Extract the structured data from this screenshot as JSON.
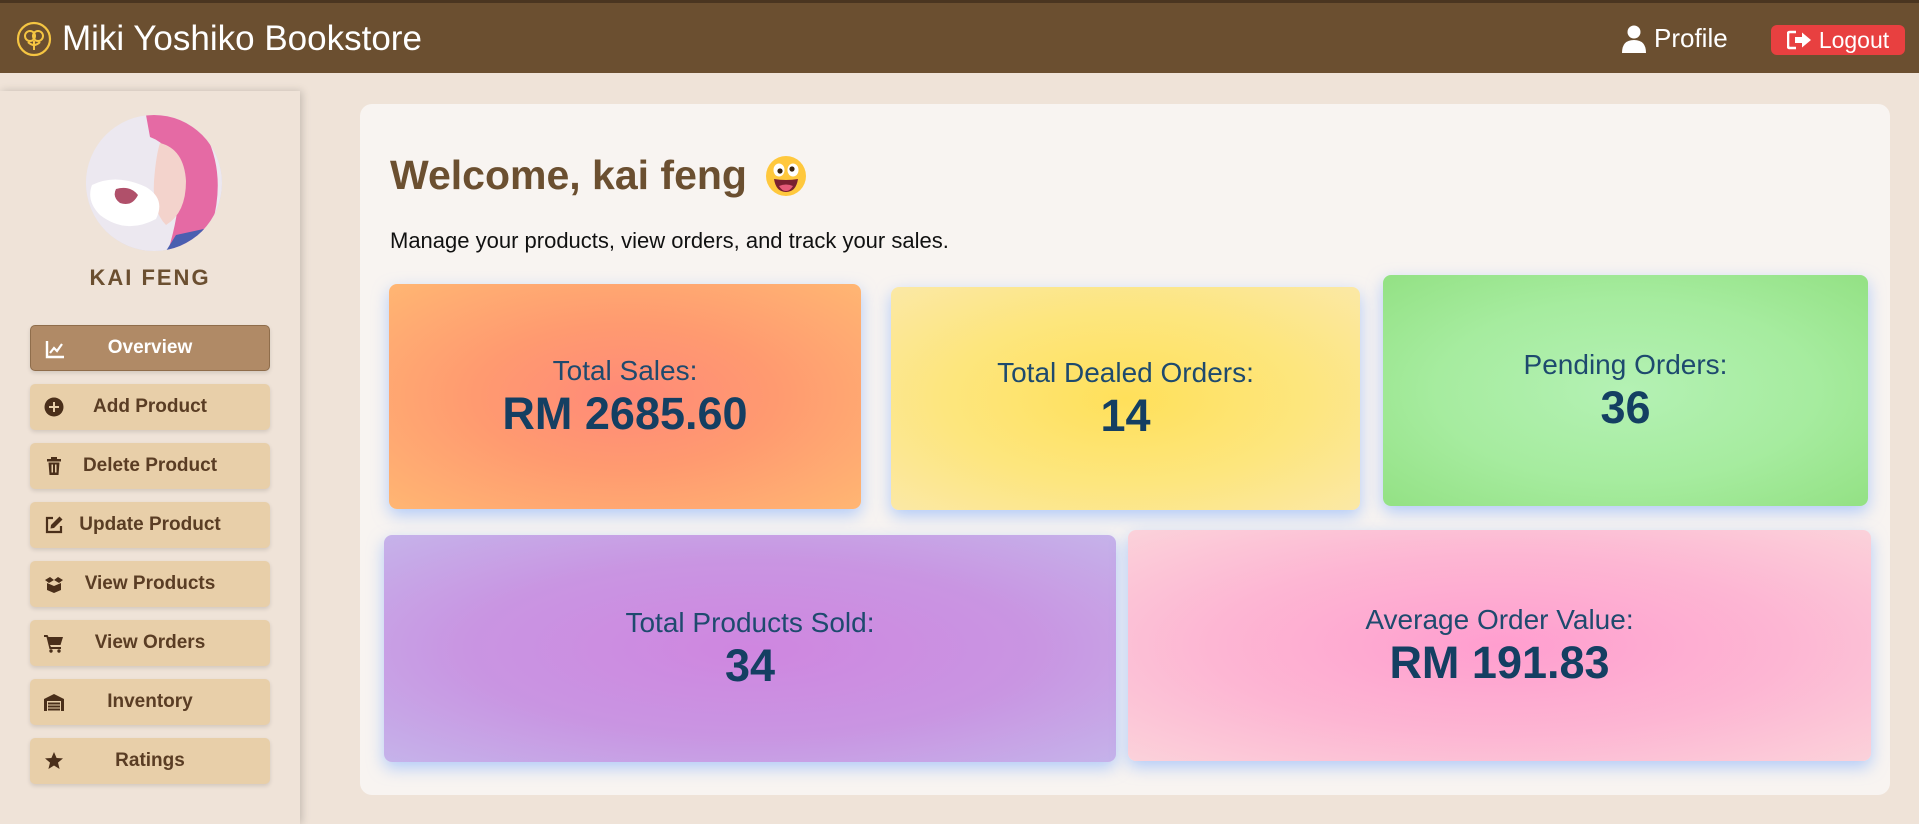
{
  "navbar": {
    "brand": "Miki Yoshiko Bookstore",
    "brand_icon": "flower-logo-icon",
    "profile_label": "Profile",
    "logout_label": "Logout"
  },
  "sidebar": {
    "user_name": "KAI FENG",
    "items": [
      {
        "label": "Overview",
        "icon": "chart-line-icon",
        "active": true
      },
      {
        "label": "Add Product",
        "icon": "plus-circle-icon"
      },
      {
        "label": "Delete Product",
        "icon": "trash-icon"
      },
      {
        "label": "Update Product",
        "icon": "edit-icon"
      },
      {
        "label": "View Products",
        "icon": "box-open-icon"
      },
      {
        "label": "View Orders",
        "icon": "cart-icon"
      },
      {
        "label": "Inventory",
        "icon": "warehouse-icon"
      },
      {
        "label": "Ratings",
        "icon": "star-icon"
      }
    ]
  },
  "main": {
    "welcome": "Welcome, kai feng",
    "subtitle": "Manage your products, view orders, and track your sales.",
    "stats": [
      {
        "label": "Total Sales:",
        "value": "RM 2685.60"
      },
      {
        "label": "Total Dealed Orders:",
        "value": "14"
      },
      {
        "label": "Pending Orders:",
        "value": "36"
      },
      {
        "label": "Total Products Sold:",
        "value": "34"
      },
      {
        "label": "Average Order Value:",
        "value": "RM 191.83"
      }
    ]
  },
  "colors": {
    "navbar": "#6b4f30",
    "accent_brown": "#6b4f30",
    "logout": "#e84040",
    "menu_bg": "#e8cfa9",
    "menu_active": "#b08a66",
    "stat_text": "#1e4a6e"
  }
}
